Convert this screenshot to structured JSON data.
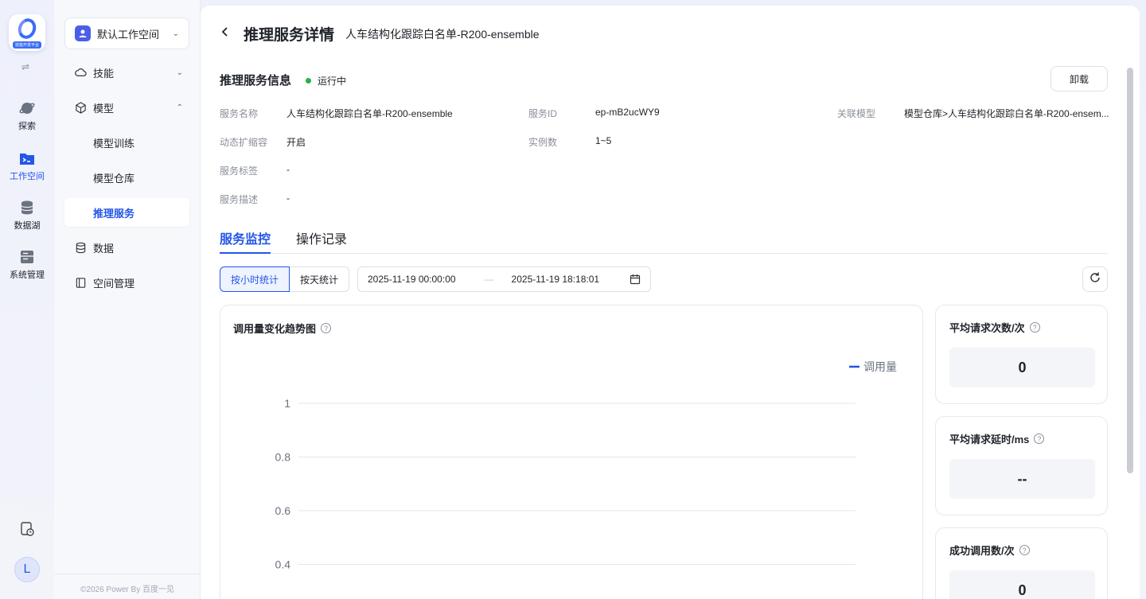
{
  "rail": {
    "logo_tag": "技能开发平台",
    "items": [
      {
        "label": "探索",
        "icon": "planet-icon"
      },
      {
        "label": "工作空间",
        "icon": "terminal-folder-icon"
      },
      {
        "label": "数据湖",
        "icon": "database-icon"
      },
      {
        "label": "系统管理",
        "icon": "server-icon"
      }
    ],
    "avatar": "L"
  },
  "sidebar": {
    "workspace": "默认工作空间",
    "items": [
      {
        "label": "技能"
      },
      {
        "label": "模型"
      },
      {
        "label": "模型训练"
      },
      {
        "label": "模型仓库"
      },
      {
        "label": "推理服务"
      },
      {
        "label": "数据"
      },
      {
        "label": "空间管理"
      }
    ],
    "copyright": "©2026 Power By 百度一见"
  },
  "header": {
    "title": "推理服务详情",
    "subtitle": "人车结构化跟踪白名单-R200-ensemble"
  },
  "info": {
    "title": "推理服务信息",
    "status": "运行中",
    "unload": "卸载",
    "fields": {
      "name_k": "服务名称",
      "name_v": "人车结构化跟踪白名单-R200-ensemble",
      "id_k": "服务ID",
      "id_v": "ep-mB2ucWY9",
      "model_k": "关联模型",
      "model_v": "模型仓库>人车结构化跟踪白名单-R200-ensem...",
      "scale_k": "动态扩缩容",
      "scale_v": "开启",
      "inst_k": "实例数",
      "inst_v": "1~5",
      "tag_k": "服务标签",
      "tag_v": "-",
      "desc_k": "服务描述",
      "desc_v": "-"
    }
  },
  "tabs": [
    "服务监控",
    "操作记录"
  ],
  "filters": {
    "hourly": "按小时统计",
    "daily": "按天统计",
    "start": "2025-11-19 00:00:00",
    "sep": "—",
    "end": "2025-11-19 18:18:01"
  },
  "chart_data": {
    "type": "line",
    "title": "调用量变化趋势图",
    "series": [
      {
        "name": "调用量",
        "values": []
      }
    ],
    "yticks": [
      "1",
      "0.8",
      "0.6",
      "0.4"
    ],
    "ylim": [
      0,
      1
    ],
    "grid": true,
    "legend": "top-right",
    "color": "#2456e8"
  },
  "metrics": [
    {
      "title": "平均请求次数/次",
      "value": "0"
    },
    {
      "title": "平均请求延时/ms",
      "value": "--"
    },
    {
      "title": "成功调用数/次",
      "value": "0"
    }
  ]
}
